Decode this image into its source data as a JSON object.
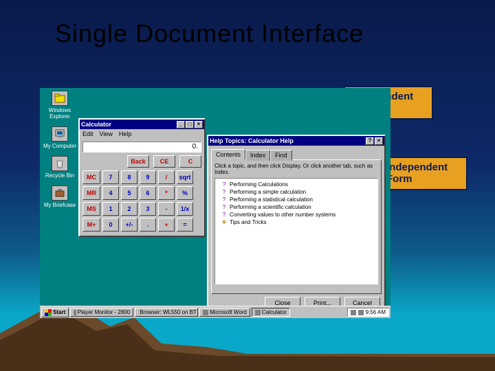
{
  "slide_title": "Single Document Interface",
  "callouts": {
    "c1": "Independent Form",
    "c2": "Independent Form"
  },
  "desktop": {
    "icons": [
      {
        "name": "windows-explorer-icon",
        "label": "Windows Explorer"
      },
      {
        "name": "my-computer-icon",
        "label": "My Computer"
      },
      {
        "name": "recycle-bin-icon",
        "label": "Recycle Bin"
      },
      {
        "name": "my-briefcase-icon",
        "label": "My Briefcase"
      }
    ]
  },
  "calculator": {
    "title": "Calculator",
    "menu": [
      "Edit",
      "View",
      "Help"
    ],
    "display": "0.",
    "top_buttons": [
      "Back",
      "CE",
      "C"
    ],
    "grid": [
      [
        "MC",
        "7",
        "8",
        "9",
        "/",
        "sqrt"
      ],
      [
        "MR",
        "4",
        "5",
        "6",
        "*",
        "%"
      ],
      [
        "MS",
        "1",
        "2",
        "3",
        "-",
        "1/x"
      ],
      [
        "M+",
        "0",
        "+/-",
        ".",
        "+",
        "="
      ]
    ]
  },
  "help": {
    "title": "Help Topics: Calculator Help",
    "tabs": [
      "Contents",
      "Index",
      "Find"
    ],
    "instruction": "Click a topic, and then click Display. Or click another tab, such as Index.",
    "items": [
      {
        "type": "topic",
        "label": "Performing Calculations"
      },
      {
        "type": "topic",
        "label": "Performing a simple calculation"
      },
      {
        "type": "topic",
        "label": "Performing a statistical calculation"
      },
      {
        "type": "topic",
        "label": "Performing a scientific calculation"
      },
      {
        "type": "topic",
        "label": "Converting values to other number systems"
      },
      {
        "type": "book",
        "label": "Tips and Tricks"
      }
    ],
    "buttons": [
      "Close",
      "Print...",
      "Cancel"
    ]
  },
  "taskbar": {
    "start": "Start",
    "items": [
      "Player Monitor - 2800",
      "Browser: WL550 on BT",
      "Microsoft Word",
      "Calculator"
    ],
    "time": "9:56 AM"
  }
}
